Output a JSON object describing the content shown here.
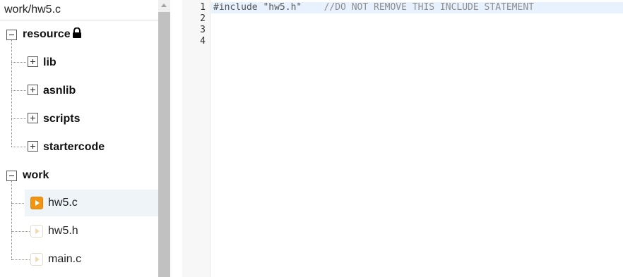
{
  "path_bar": {
    "text": "work/hw5.c"
  },
  "tree": {
    "resource": {
      "label": "resource",
      "locked": true,
      "children": [
        {
          "label": "lib"
        },
        {
          "label": "asnlib"
        },
        {
          "label": "scripts"
        },
        {
          "label": "startercode"
        }
      ]
    },
    "work": {
      "label": "work",
      "files": [
        {
          "label": "hw5.c",
          "active": true
        },
        {
          "label": "hw5.h",
          "active": false
        },
        {
          "label": "main.c",
          "active": false
        }
      ]
    }
  },
  "editor": {
    "line_numbers": [
      "1",
      "2",
      "3",
      "4"
    ],
    "line1": {
      "directive": "#include",
      "string": "\"hw5.h\"",
      "comment": "//DO NOT REMOVE THIS INCLUDE STATEMENT"
    }
  },
  "colors": {
    "active_file_icon": "#f29411",
    "selected_row": "#eef4f7",
    "active_line": "#e8f2fe"
  }
}
